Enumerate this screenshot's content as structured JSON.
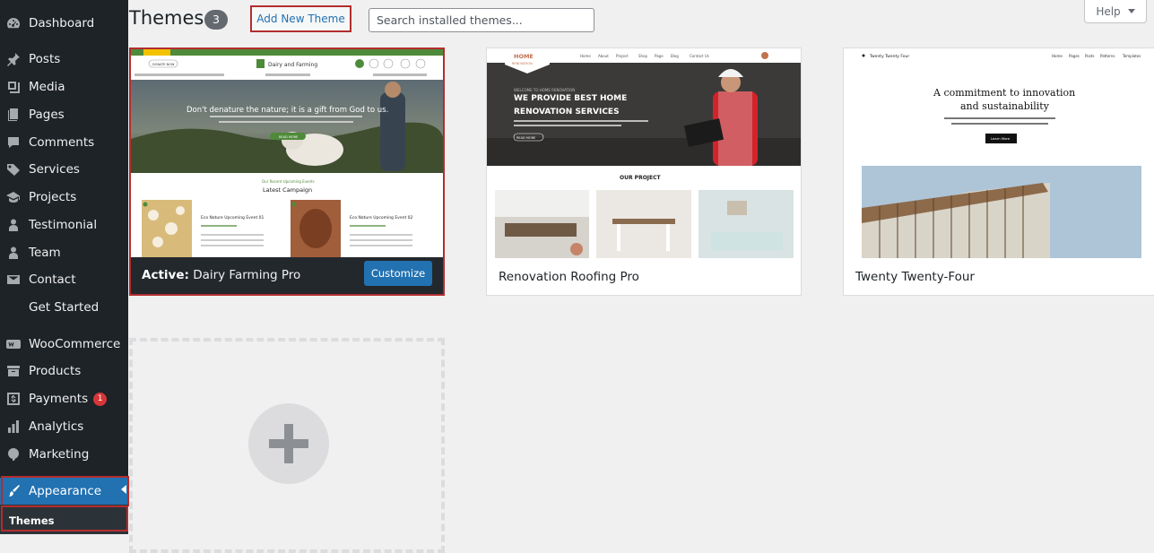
{
  "sidebar": {
    "items": [
      {
        "id": "dashboard",
        "label": "Dashboard",
        "icon": "dashboard-icon"
      },
      {
        "id": "posts",
        "label": "Posts",
        "icon": "pin-icon"
      },
      {
        "id": "media",
        "label": "Media",
        "icon": "media-icon"
      },
      {
        "id": "pages",
        "label": "Pages",
        "icon": "pages-icon"
      },
      {
        "id": "comments",
        "label": "Comments",
        "icon": "comment-icon"
      },
      {
        "id": "services",
        "label": "Services",
        "icon": "tag-icon"
      },
      {
        "id": "projects",
        "label": "Projects",
        "icon": "graduation-cap-icon"
      },
      {
        "id": "testimonial",
        "label": "Testimonial",
        "icon": "user-icon"
      },
      {
        "id": "team",
        "label": "Team",
        "icon": "user-icon"
      },
      {
        "id": "contact",
        "label": "Contact",
        "icon": "mail-icon"
      },
      {
        "id": "get-started",
        "label": "Get Started",
        "icon": ""
      },
      {
        "id": "woocommerce",
        "label": "WooCommerce",
        "icon": "woo-icon"
      },
      {
        "id": "products",
        "label": "Products",
        "icon": "archive-icon"
      },
      {
        "id": "payments",
        "label": "Payments",
        "icon": "dollar-icon",
        "badge": "1"
      },
      {
        "id": "analytics",
        "label": "Analytics",
        "icon": "bar-chart-icon"
      },
      {
        "id": "marketing",
        "label": "Marketing",
        "icon": "megaphone-icon"
      }
    ],
    "active": {
      "label": "Appearance",
      "icon": "brush-icon"
    },
    "submenu": {
      "label": "Themes"
    }
  },
  "header": {
    "title": "Themes",
    "count": "3",
    "add_new_label": "Add New Theme",
    "search_placeholder": "Search installed themes...",
    "help_label": "Help"
  },
  "themes": [
    {
      "name": "Dairy Farming Pro",
      "active_prefix": "Active:",
      "customize_label": "Customize",
      "preview": {
        "donate": "DONATE NOW",
        "brand": "Dairy and Farming",
        "hero_text": "Don't denature the nature; it is a gift from God to us.",
        "read_more": "READ MORE",
        "kicker": "Our Recent Upcoming Events",
        "section_title": "Latest Campaign",
        "event1": "Eco Nature Upcoming Event 01",
        "event2": "Eco Nature Upcoming Event 02"
      }
    },
    {
      "name": "Renovation Roofing Pro",
      "preview": {
        "logo_line1": "HOME",
        "logo_line2": "RENOVATION",
        "kicker": "WELCOME TO HOME RENOVATION",
        "headline1": "WE PROVIDE BEST HOME",
        "headline2": "RENOVATION SERVICES",
        "read_more": "READ MORE",
        "section_title": "OUR PROJECT",
        "nav": [
          "Home",
          "About",
          "Project",
          "Shop",
          "Page",
          "Blog",
          "Contact Us"
        ]
      }
    },
    {
      "name": "Twenty Twenty-Four",
      "preview": {
        "site_title": "Twenty Twenty Four",
        "nav": [
          "Home",
          "Pages",
          "Posts",
          "Patterns",
          "Templates"
        ],
        "headline1": "A commitment to innovation",
        "headline2": "and sustainability",
        "learn_more": "Learn More"
      }
    }
  ],
  "colors": {
    "sidebar_bg": "#1d2327",
    "accent": "#2271b1",
    "highlight": "#b32d2e",
    "badge": "#d63638"
  }
}
